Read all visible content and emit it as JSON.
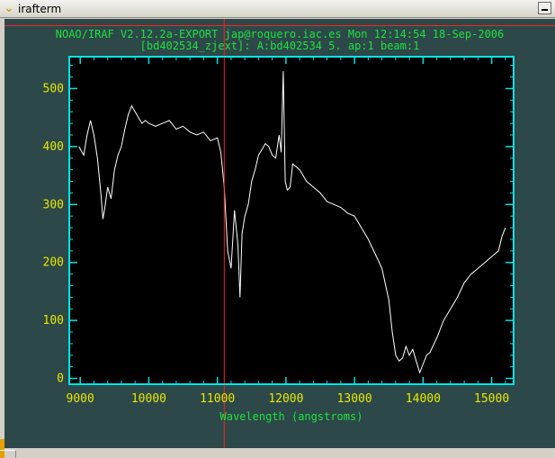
{
  "window": {
    "title": "irafterm",
    "menu_icon": "chevron-down-icon",
    "minimize_icon": "minimize-icon"
  },
  "plot": {
    "header_line1": "NOAO/IRAF V2.12.2a-EXPORT jap@roquero.iac.es Mon 12:14:54 18-Sep-2006",
    "header_line2": "[bd402534_zjext]: A:bd402534 5. ap:1 beam:1",
    "colors": {
      "background": "#000000",
      "frame": "#00e5e5",
      "ticks_text": "#e8e800",
      "header_text": "#20e040",
      "cursor_line": "#ff2020",
      "spectrum": "#ffffff",
      "terminal_bg": "#2c4848"
    }
  },
  "chart_data": {
    "type": "line",
    "title": "NOAO/IRAF V2.12.2a-EXPORT jap@roquero.iac.es Mon 12:14:54 18-Sep-2006",
    "subtitle": "[bd402534_zjext]: A:bd402534 5. ap:1 beam:1",
    "xlabel": "Wavelength (angstroms)",
    "ylabel": "",
    "xlim": [
      8840,
      15320
    ],
    "ylim": [
      -10,
      555
    ],
    "xticks": [
      9000,
      10000,
      11000,
      12000,
      13000,
      14000,
      15000
    ],
    "yticks": [
      0,
      100,
      200,
      300,
      400,
      500
    ],
    "cursor_x": 11100,
    "grid": false,
    "series": [
      {
        "x": [
          8980,
          9050,
          9100,
          9150,
          9200,
          9250,
          9300,
          9330,
          9360,
          9400,
          9450,
          9500,
          9550,
          9600,
          9650,
          9700,
          9750,
          9800,
          9850,
          9900,
          9950,
          10000,
          10100,
          10200,
          10300,
          10400,
          10500,
          10600,
          10700,
          10800,
          10900,
          11000,
          11050,
          11100,
          11150,
          11200,
          11250,
          11300,
          11330,
          11360,
          11400,
          11450,
          11500,
          11550,
          11600,
          11650,
          11700,
          11750,
          11800,
          11850,
          11900,
          11930,
          11960,
          11990,
          12020,
          12060,
          12100,
          12200,
          12300,
          12400,
          12500,
          12600,
          12700,
          12800,
          12900,
          13000,
          13100,
          13200,
          13300,
          13400,
          13500,
          13550,
          13600,
          13650,
          13700,
          13750,
          13800,
          13850,
          13900,
          13950,
          14000,
          14050,
          14100,
          14200,
          14300,
          14400,
          14500,
          14600,
          14700,
          14800,
          14900,
          15000,
          15100,
          15150,
          15200
        ],
        "y": [
          400,
          385,
          420,
          445,
          420,
          380,
          320,
          275,
          295,
          330,
          310,
          360,
          385,
          400,
          430,
          455,
          470,
          460,
          450,
          440,
          445,
          440,
          435,
          440,
          445,
          430,
          435,
          425,
          420,
          425,
          410,
          415,
          390,
          330,
          220,
          190,
          290,
          230,
          140,
          250,
          280,
          300,
          340,
          360,
          385,
          395,
          405,
          400,
          385,
          380,
          420,
          390,
          530,
          340,
          325,
          330,
          370,
          360,
          340,
          330,
          320,
          305,
          300,
          295,
          285,
          280,
          260,
          240,
          215,
          190,
          135,
          80,
          40,
          30,
          35,
          55,
          40,
          50,
          30,
          10,
          25,
          40,
          45,
          70,
          100,
          120,
          140,
          165,
          180,
          190,
          200,
          210,
          220,
          245,
          260
        ]
      }
    ]
  }
}
